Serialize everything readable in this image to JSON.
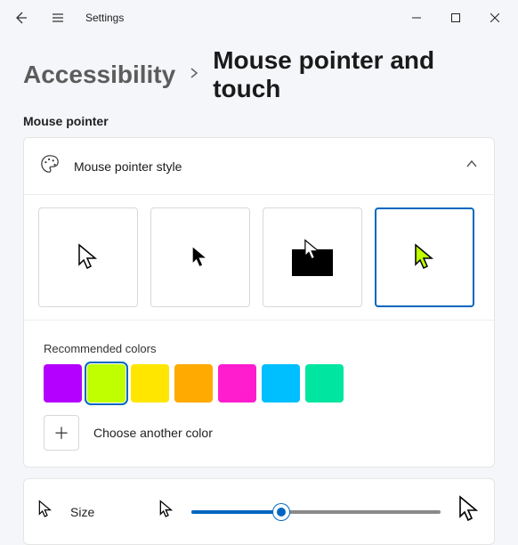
{
  "titlebar": {
    "title": "Settings"
  },
  "breadcrumb": {
    "parent": "Accessibility",
    "current": "Mouse pointer and touch"
  },
  "subheading": "Mouse pointer",
  "style_section": {
    "title": "Mouse pointer style",
    "expanded": true,
    "options": [
      {
        "name": "white",
        "selected": false
      },
      {
        "name": "black",
        "selected": false
      },
      {
        "name": "inverted",
        "selected": false
      },
      {
        "name": "custom",
        "selected": true,
        "color": "#bfff00"
      }
    ]
  },
  "colors": {
    "label": "Recommended colors",
    "swatches": [
      {
        "hex": "#b400ff",
        "selected": false
      },
      {
        "hex": "#bfff00",
        "selected": true
      },
      {
        "hex": "#ffe600",
        "selected": false
      },
      {
        "hex": "#ffaa00",
        "selected": false
      },
      {
        "hex": "#ff1dce",
        "selected": false
      },
      {
        "hex": "#00bfff",
        "selected": false
      },
      {
        "hex": "#00e5a0",
        "selected": false
      }
    ],
    "choose_label": "Choose another color"
  },
  "size": {
    "label": "Size",
    "value_percent": 36
  }
}
